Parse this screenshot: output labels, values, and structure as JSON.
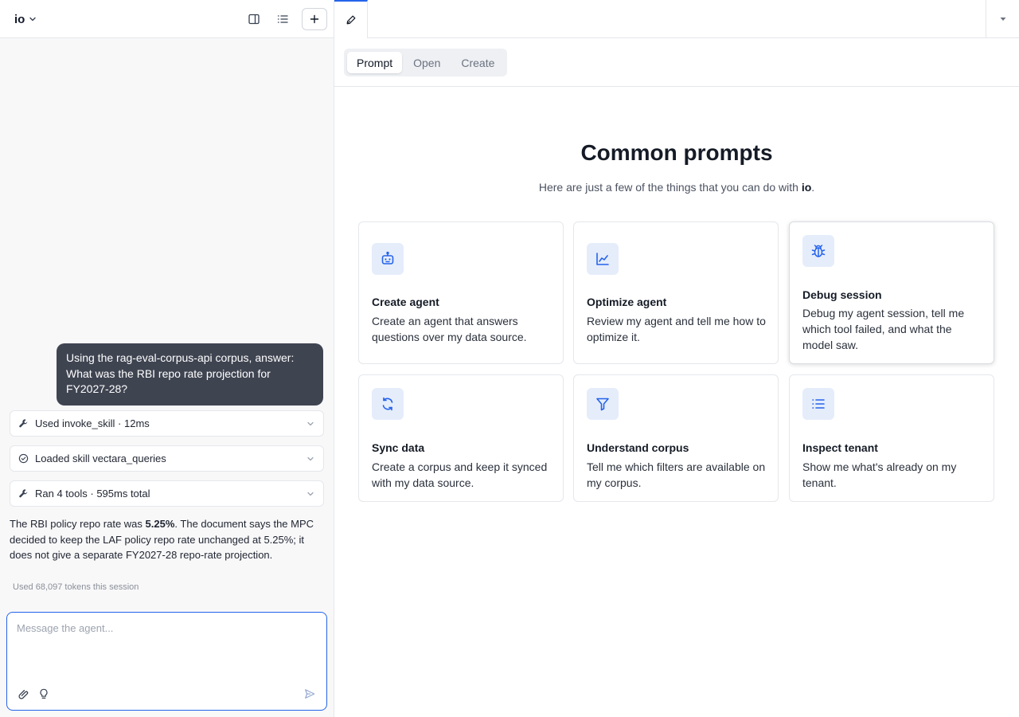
{
  "app": {
    "name": "io"
  },
  "left_header": {
    "toggle_panel_icon": "sidebar-icon",
    "sessions_icon": "list-icon",
    "new_label": "+"
  },
  "chat": {
    "user_message": "Using the rag-eval-corpus-api corpus, answer: What was the RBI repo rate projection for FY2027-28?",
    "tool_rows": [
      {
        "label": "Used invoke_skill · 12ms",
        "icon": "wrench-icon"
      },
      {
        "label": "Loaded skill vectara_queries",
        "icon": "check-circle-icon"
      },
      {
        "label": "Ran 4 tools · 595ms total",
        "icon": "wrench-icon"
      }
    ],
    "answer_before": "The RBI policy repo rate was ",
    "answer_bold": "5.25%",
    "answer_after": ". The document says the MPC decided to keep the LAF policy repo rate unchanged at 5.25%; it does not give a separate FY2027-28 repo-rate projection.",
    "tokens": "Used 68,097 tokens this session"
  },
  "composer": {
    "placeholder": "Message the agent..."
  },
  "segmented": [
    "Prompt",
    "Open",
    "Create"
  ],
  "prompts_section": {
    "title": "Common prompts",
    "subtitle_before": "Here are just a few of the things that you can do with ",
    "subtitle_bold": "io",
    "subtitle_after": "."
  },
  "cards": [
    {
      "title": "Create agent",
      "desc": "Create an agent that answers questions over my data source.",
      "icon": "robot-icon"
    },
    {
      "title": "Optimize agent",
      "desc": "Review my agent and tell me how to optimize it.",
      "icon": "chart-line-icon"
    },
    {
      "title": "Debug session",
      "desc": "Debug my agent session, tell me which tool failed, and what the model saw.",
      "icon": "bug-icon"
    },
    {
      "title": "Sync data",
      "desc": "Create a corpus and keep it synced with my data source.",
      "icon": "sync-icon"
    },
    {
      "title": "Understand corpus",
      "desc": "Tell me which filters are available on my corpus.",
      "icon": "filter-icon"
    },
    {
      "title": "Inspect tenant",
      "desc": "Show me what's already on my tenant.",
      "icon": "list-icon"
    }
  ],
  "colors": {
    "accent": "#2563eb",
    "icon_bg": "#e5edfb",
    "icon_fg": "#2563eb",
    "user_bubble": "#3f4451"
  }
}
